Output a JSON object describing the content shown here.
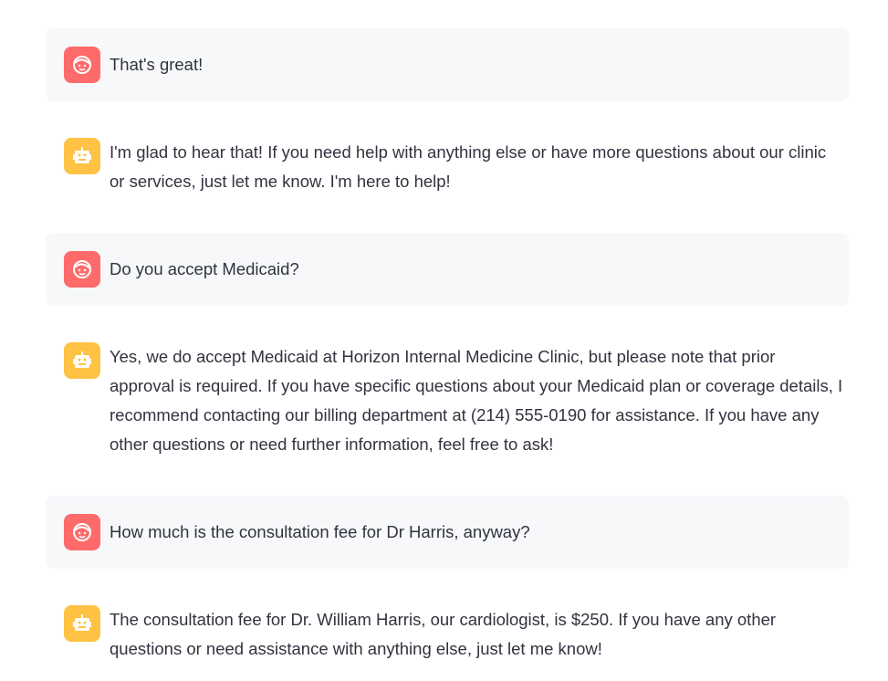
{
  "messages": [
    {
      "role": "user",
      "avatar_icon": "user-face-icon",
      "lines": [
        "That's great!"
      ]
    },
    {
      "role": "assistant",
      "avatar_icon": "robot-icon",
      "lines": [
        "I'm glad to hear that! If you need help with anything else or have more questions about our clinic",
        "or services, just let me know. I'm here to help!"
      ]
    },
    {
      "role": "user",
      "avatar_icon": "user-face-icon",
      "lines": [
        "Do you accept Medicaid?"
      ]
    },
    {
      "role": "assistant",
      "avatar_icon": "robot-icon",
      "lines": [
        "Yes, we do accept Medicaid at Horizon Internal Medicine Clinic, but please note that prior",
        "approval is required. If you have specific questions about your Medicaid plan or coverage details, I",
        "recommend contacting our billing department at (214) 555-0190 for assistance. If you have any",
        "other questions or need further information, feel free to ask!"
      ]
    },
    {
      "role": "user",
      "avatar_icon": "user-face-icon",
      "lines": [
        "How much is the consultation fee for Dr Harris, anyway?"
      ]
    },
    {
      "role": "assistant",
      "avatar_icon": "robot-icon",
      "lines": [
        "The consultation fee for Dr. William Harris, our cardiologist, is $250. If you have any other",
        "questions or need assistance with anything else, just let me know!"
      ]
    }
  ],
  "colors": {
    "user_avatar": "#ff6b6b",
    "assistant_avatar": "#ffc244",
    "user_bubble": "#f7f8fa",
    "text": "#31333f"
  }
}
